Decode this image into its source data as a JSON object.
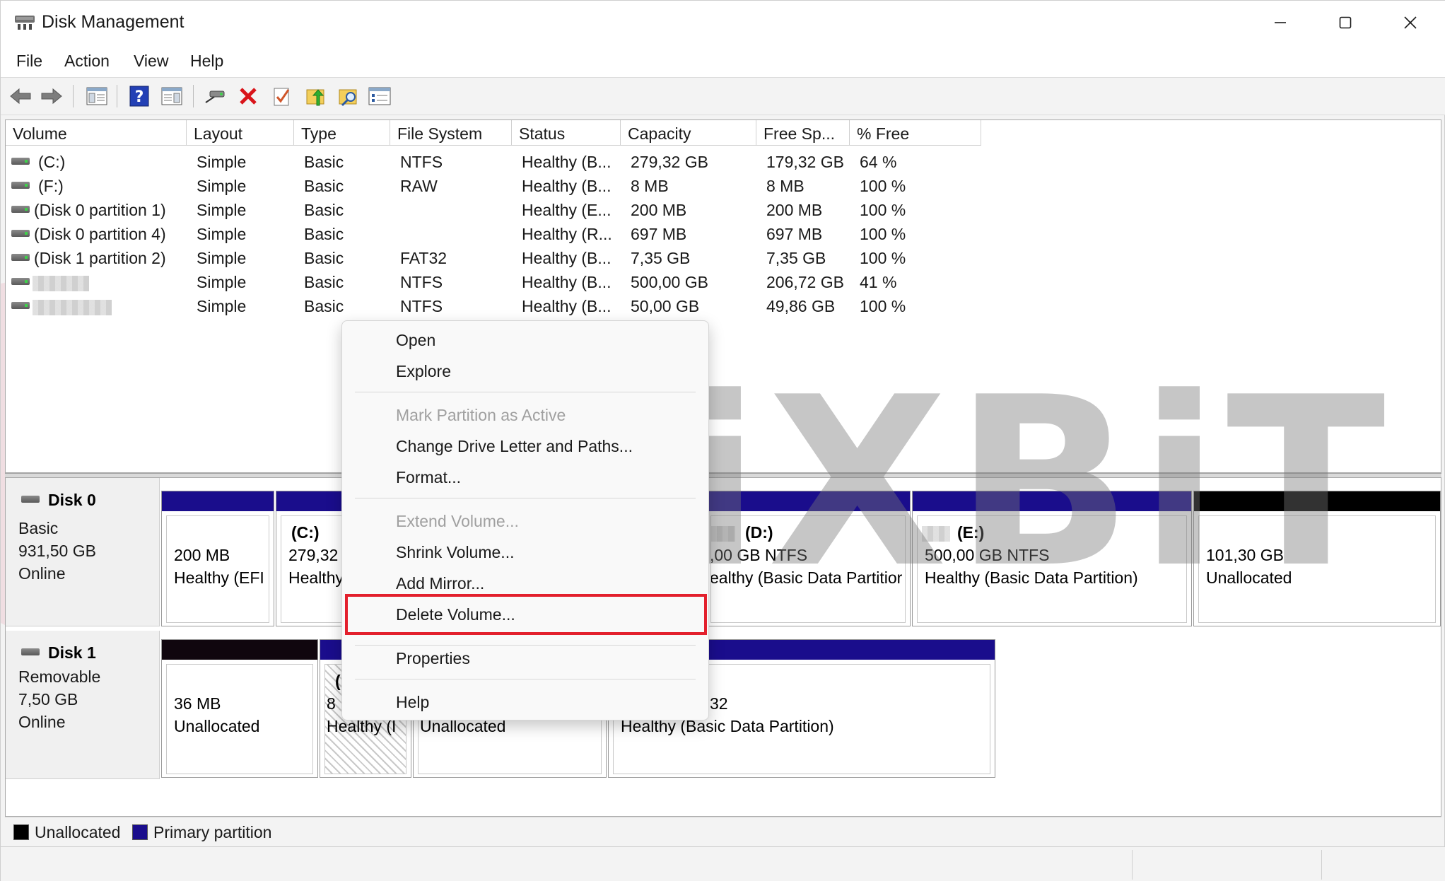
{
  "window": {
    "title": "Disk Management",
    "controls": {
      "minimize": "minimize",
      "maximize": "maximize",
      "close": "close"
    }
  },
  "menu": [
    "File",
    "Action",
    "View",
    "Help"
  ],
  "toolbar_icons": [
    "back-arrow-icon",
    "forward-arrow-icon",
    "show-hide-console-tree-icon",
    "help-icon",
    "properties-icon",
    "connect-icon",
    "delete-icon",
    "check-icon",
    "up-folder-icon",
    "search-folder-icon",
    "list-icon"
  ],
  "volume_table": {
    "columns": [
      "Volume",
      "Layout",
      "Type",
      "File System",
      "Status",
      "Capacity",
      "Free Sp...",
      "% Free"
    ],
    "rows": [
      {
        "volume": "(C:)",
        "layout": "Simple",
        "type": "Basic",
        "fs": "NTFS",
        "status": "Healthy (B...",
        "capacity": "279,32 GB",
        "free": "179,32 GB",
        "pct": "64 %"
      },
      {
        "volume": "(F:)",
        "layout": "Simple",
        "type": "Basic",
        "fs": "RAW",
        "status": "Healthy (B...",
        "capacity": "8 MB",
        "free": "8 MB",
        "pct": "100 %"
      },
      {
        "volume": "(Disk 0 partition 1)",
        "layout": "Simple",
        "type": "Basic",
        "fs": "",
        "status": "Healthy (E...",
        "capacity": "200 MB",
        "free": "200 MB",
        "pct": "100 %"
      },
      {
        "volume": "(Disk 0 partition 4)",
        "layout": "Simple",
        "type": "Basic",
        "fs": "",
        "status": "Healthy (R...",
        "capacity": "697 MB",
        "free": "697 MB",
        "pct": "100 %"
      },
      {
        "volume": "(Disk 1 partition 2)",
        "layout": "Simple",
        "type": "Basic",
        "fs": "FAT32",
        "status": "Healthy (B...",
        "capacity": "7,35 GB",
        "free": "7,35 GB",
        "pct": "100 %"
      },
      {
        "volume": "",
        "layout": "Simple",
        "type": "Basic",
        "fs": "NTFS",
        "status": "Healthy (B...",
        "capacity": "500,00 GB",
        "free": "206,72 GB",
        "pct": "41 %"
      },
      {
        "volume": "",
        "layout": "Simple",
        "type": "Basic",
        "fs": "NTFS",
        "status": "Healthy (B...",
        "capacity": "50,00 GB",
        "free": "49,86 GB",
        "pct": "100 %"
      }
    ]
  },
  "disks": [
    {
      "name": "Disk 0",
      "type": "Basic",
      "size": "931,50 GB",
      "state": "Online",
      "partitions": [
        {
          "name": "",
          "line1": "200 MB",
          "line2": "Healthy (EFI"
        },
        {
          "name": "(C:)",
          "line1": "279,32 (",
          "line2": "Healthy"
        },
        {
          "name": "(D:)",
          "line1": ",00 GB NTFS",
          "line2": "ealthy (Basic Data Partitior"
        },
        {
          "name": "(E:)",
          "line1": "500,00 GB NTFS",
          "line2": "Healthy (Basic Data Partition)"
        },
        {
          "name": "",
          "line1": "101,30 GB",
          "line2": "Unallocated"
        }
      ]
    },
    {
      "name": "Disk 1",
      "type": "Removable",
      "size": "7,50 GB",
      "state": "Online",
      "partitions": [
        {
          "name": "",
          "line1": "36 MB",
          "line2": "Unallocated"
        },
        {
          "name": "(",
          "line1": "8",
          "line2": "Healthy (I"
        },
        {
          "name": "",
          "line1": "",
          "line2": "Unallocated"
        },
        {
          "name": "",
          "line1": "32",
          "line2": "Healthy (Basic Data Partition)"
        }
      ]
    }
  ],
  "legend": {
    "unallocated": "Unallocated",
    "primary": "Primary partition",
    "unallocated_color": "#000000",
    "primary_color": "#1a0d8c"
  },
  "watermark": "BiXBiT",
  "context_menu": {
    "items": [
      "Open",
      "Explore",
      "Mark Partition as Active",
      "Change Drive Letter and Paths...",
      "Format...",
      "Extend Volume...",
      "Shrink Volume...",
      "Add Mirror...",
      "Delete Volume...",
      "Properties",
      "Help"
    ],
    "highlighted": "Delete Volume...",
    "highlight_color": "#e3202d"
  }
}
